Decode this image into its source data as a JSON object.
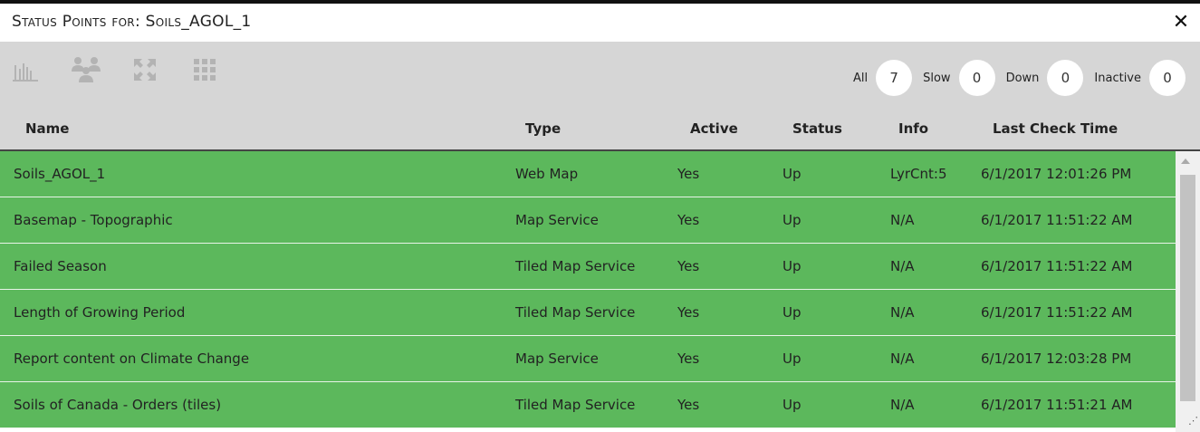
{
  "window": {
    "title": "Status Points for: Soils_AGOL_1",
    "close_label": "✕"
  },
  "toolbar": {
    "tools": [
      {
        "name": "chart-icon"
      },
      {
        "name": "group-icon"
      },
      {
        "name": "expand-icon"
      },
      {
        "name": "grid-icon"
      }
    ],
    "counters": {
      "all_label": "All",
      "all_value": "7",
      "slow_label": "Slow",
      "slow_value": "0",
      "down_label": "Down",
      "down_value": "0",
      "inactive_label": "Inactive",
      "inactive_value": "0"
    }
  },
  "table": {
    "columns": [
      "Name",
      "Type",
      "Active",
      "Status",
      "Info",
      "Last Check Time"
    ],
    "rows": [
      {
        "name": "Soils_AGOL_1",
        "type": "Web Map",
        "active": "Yes",
        "status": "Up",
        "info": "LyrCnt:5",
        "last_check": "6/1/2017 12:01:26 PM"
      },
      {
        "name": "Basemap - Topographic",
        "type": "Map Service",
        "active": "Yes",
        "status": "Up",
        "info": "N/A",
        "last_check": "6/1/2017 11:51:22 AM"
      },
      {
        "name": "Failed Season",
        "type": "Tiled Map Service",
        "active": "Yes",
        "status": "Up",
        "info": "N/A",
        "last_check": "6/1/2017 11:51:22 AM"
      },
      {
        "name": "Length of Growing Period",
        "type": "Tiled Map Service",
        "active": "Yes",
        "status": "Up",
        "info": "N/A",
        "last_check": "6/1/2017 11:51:22 AM"
      },
      {
        "name": "Report content on Climate Change",
        "type": "Map Service",
        "active": "Yes",
        "status": "Up",
        "info": "N/A",
        "last_check": "6/1/2017 12:03:28 PM"
      },
      {
        "name": "Soils of Canada - Orders (tiles)",
        "type": "Tiled Map Service",
        "active": "Yes",
        "status": "Up",
        "info": "N/A",
        "last_check": "6/1/2017 11:51:21 AM"
      }
    ]
  },
  "colors": {
    "row_up": "#5cb85c",
    "toolbar_bg": "#d6d6d6"
  }
}
